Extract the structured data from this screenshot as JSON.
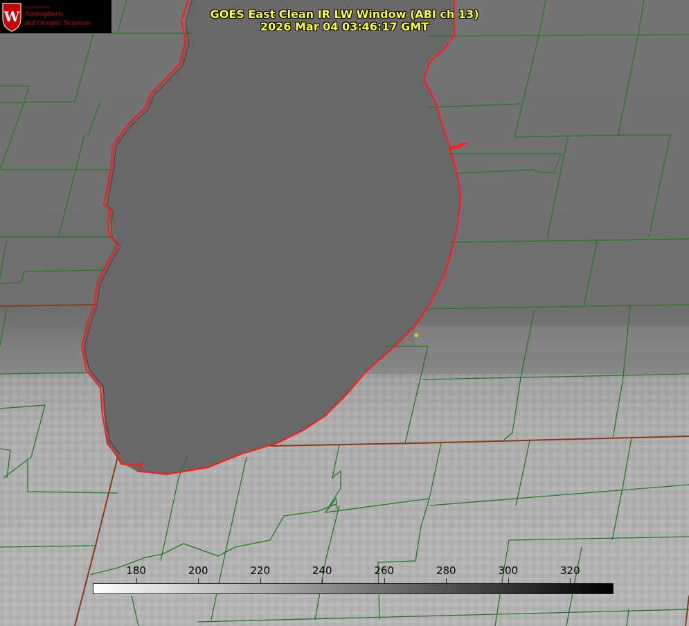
{
  "title": {
    "line1": "GOES East Clean IR LW Window (ABI ch 13)",
    "line2": "2026 Mar 04 03:46:17 GMT"
  },
  "logo": {
    "department": "Department of",
    "line1": "Atmospheric",
    "line2": "and Oceanic Sciences",
    "crest_letter": "W"
  },
  "colorbar": {
    "min": 166,
    "max": 334,
    "ticks": [
      "180",
      "200",
      "220",
      "240",
      "260",
      "280",
      "300",
      "320"
    ],
    "gradient_from": "#ffffff",
    "gradient_to": "#000000"
  },
  "colors": {
    "lake_fill": "#686868",
    "land_dark": "#6e6e6e",
    "cloud_light": "#b4b4b4",
    "county_lines": "#1f7a1f",
    "state_lines": "#8a3a10",
    "coastline": "#ff1a1a",
    "title_text": "#ffff33",
    "station_marker": "#cccc22"
  }
}
